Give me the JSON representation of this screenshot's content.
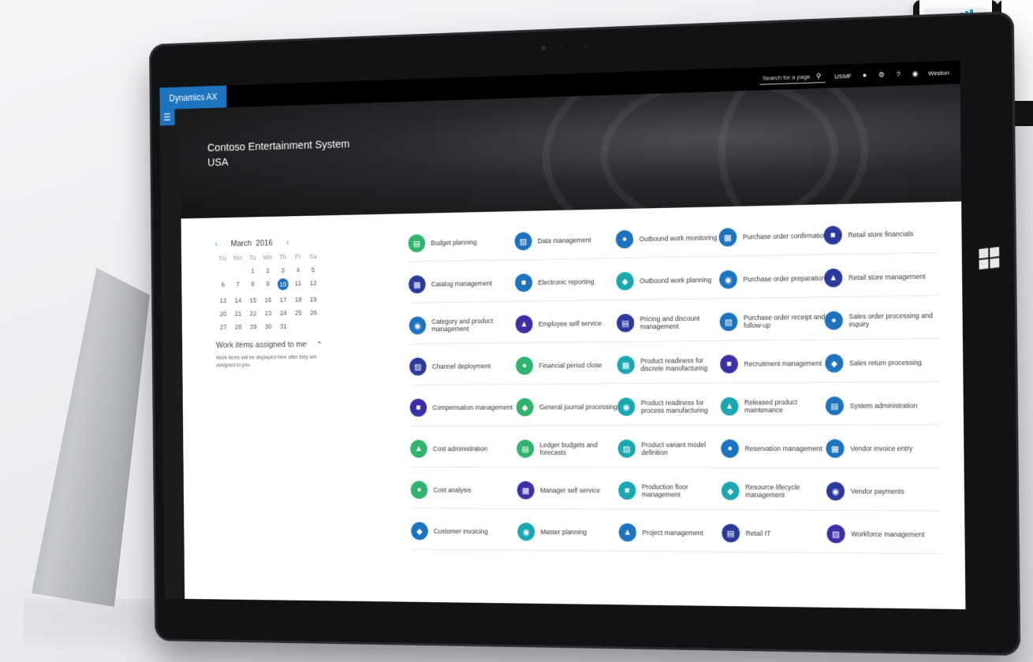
{
  "app": {
    "brand": "Dynamics AX"
  },
  "topbar": {
    "search_placeholder": "Search for a page",
    "company": "USMF",
    "user": "Weston"
  },
  "hero": {
    "line1": "Contoso Entertainment System",
    "line2": "USA"
  },
  "calendar": {
    "month": "March",
    "year": "2016",
    "dow": [
      "Su",
      "Mo",
      "Tu",
      "We",
      "Th",
      "Fr",
      "Sa"
    ],
    "weeks": [
      [
        "",
        "",
        "1",
        "2",
        "3",
        "4",
        "5"
      ],
      [
        "6",
        "7",
        "8",
        "9",
        "10",
        "11",
        "12"
      ],
      [
        "13",
        "14",
        "15",
        "16",
        "17",
        "18",
        "19"
      ],
      [
        "20",
        "21",
        "22",
        "23",
        "24",
        "25",
        "26"
      ],
      [
        "27",
        "28",
        "29",
        "30",
        "31",
        "",
        ""
      ]
    ],
    "selected_day": "10"
  },
  "work_items": {
    "title": "Work items assigned to me",
    "note": "Work items will be displayed here after they are assigned to you."
  },
  "colors": {
    "accent": "#1e73be",
    "green": "#2fb36d",
    "navy": "#2b3a9a",
    "teal": "#1aa7b0",
    "indigo": "#3b2fa6"
  },
  "columns": [
    [
      {
        "label": "Budget planning",
        "color": "#2fb36d"
      },
      {
        "label": "Catalog management",
        "color": "#2b3a9a"
      },
      {
        "label": "Category and product management",
        "color": "#1e73be"
      },
      {
        "label": "Channel deployment",
        "color": "#2b3a9a"
      },
      {
        "label": "Compensation management",
        "color": "#3b2fa6"
      },
      {
        "label": "Cost administration",
        "color": "#2fb36d"
      },
      {
        "label": "Cost analysis",
        "color": "#2fb36d"
      },
      {
        "label": "Customer invoicing",
        "color": "#1e73be"
      }
    ],
    [
      {
        "label": "Data management",
        "color": "#1e73be"
      },
      {
        "label": "Electronic reporting",
        "color": "#1e73be"
      },
      {
        "label": "Employee self service",
        "color": "#3b2fa6"
      },
      {
        "label": "Financial period close",
        "color": "#2fb36d"
      },
      {
        "label": "General journal processing",
        "color": "#2fb36d"
      },
      {
        "label": "Ledger budgets and forecasts",
        "color": "#2fb36d"
      },
      {
        "label": "Manager self service",
        "color": "#3b2fa6"
      },
      {
        "label": "Master planning",
        "color": "#1aa7b0"
      }
    ],
    [
      {
        "label": "Outbound work monitoring",
        "color": "#1e73be"
      },
      {
        "label": "Outbound work planning",
        "color": "#1aa7b0"
      },
      {
        "label": "Pricing and discount management",
        "color": "#2b3a9a"
      },
      {
        "label": "Product readiness for discrete manufacturing",
        "color": "#1aa7b0"
      },
      {
        "label": "Product readiness for process manufacturing",
        "color": "#1aa7b0"
      },
      {
        "label": "Product variant model definition",
        "color": "#1aa7b0"
      },
      {
        "label": "Production floor management",
        "color": "#1aa7b0"
      },
      {
        "label": "Project management",
        "color": "#1e73be"
      }
    ],
    [
      {
        "label": "Purchase order confirmation",
        "color": "#1e73be"
      },
      {
        "label": "Purchase order preparation",
        "color": "#1e73be"
      },
      {
        "label": "Purchase order receipt and follow-up",
        "color": "#1e73be"
      },
      {
        "label": "Recruitment management",
        "color": "#3b2fa6"
      },
      {
        "label": "Released product maintenance",
        "color": "#1aa7b0"
      },
      {
        "label": "Reservation management",
        "color": "#1e73be"
      },
      {
        "label": "Resource lifecycle management",
        "color": "#1aa7b0"
      },
      {
        "label": "Retail IT",
        "color": "#2b3a9a"
      }
    ],
    [
      {
        "label": "Retail store financials",
        "color": "#2b3a9a"
      },
      {
        "label": "Retail store management",
        "color": "#2b3a9a"
      },
      {
        "label": "Sales order processing and inquiry",
        "color": "#1e73be"
      },
      {
        "label": "Sales return processing",
        "color": "#1e73be"
      },
      {
        "label": "System administration",
        "color": "#1e73be"
      },
      {
        "label": "Vendor invoice entry",
        "color": "#1e73be"
      },
      {
        "label": "Vendor payments",
        "color": "#2b3a9a"
      },
      {
        "label": "Workforce management",
        "color": "#3b2fa6"
      }
    ]
  ]
}
